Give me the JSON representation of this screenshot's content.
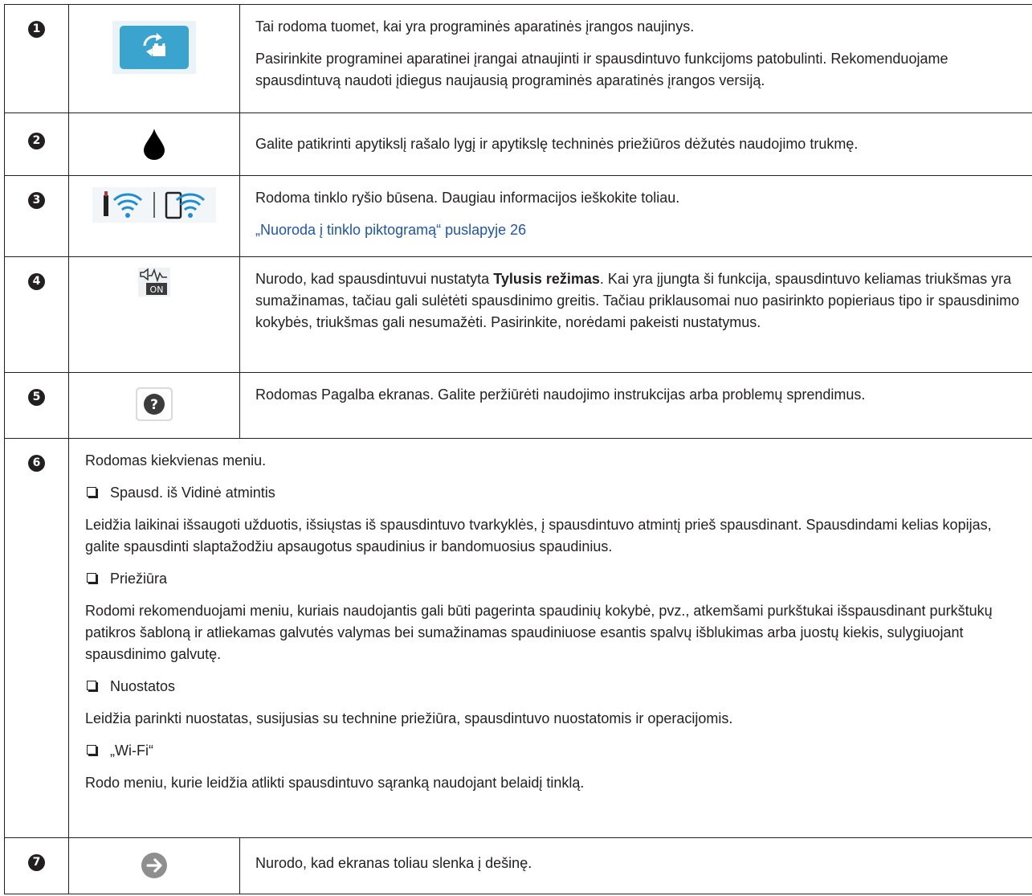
{
  "rows": [
    {
      "number": "1",
      "icon": "firmware-update-icon",
      "paragraphs": [
        "Tai rodoma tuomet, kai yra programinės aparatinės įrangos naujinys.",
        "Pasirinkite programinei aparatinei įrangai atnaujinti ir spausdintuvo funkcijoms patobulinti. Rekomenduojame spausdintuvą naudoti įdiegus naujausią programinės aparatinės įrangos versiją."
      ]
    },
    {
      "number": "2",
      "icon": "ink-drop-icon",
      "paragraphs": [
        "Galite patikrinti apytikslį rašalo lygį ir apytikslę techninės priežiūros dėžutės naudojimo trukmę."
      ]
    },
    {
      "number": "3",
      "icon": "network-status-icon",
      "paragraphs": [
        "Rodoma tinklo ryšio būsena. Daugiau informacijos ieškokite toliau."
      ],
      "link": "„Nuoroda į tinklo piktogramą“ puslapyje 26"
    },
    {
      "number": "4",
      "icon": "quiet-mode-on-icon",
      "icon_text": "ON",
      "text_before": "Nurodo, kad spausdintuvui nustatyta ",
      "text_bold": "Tylusis režimas",
      "text_after": ". Kai yra įjungta ši funkcija, spausdintuvo keliamas triukšmas yra sumažinamas, tačiau gali sulėtėti spausdinimo greitis. Tačiau priklausomai nuo pasirinkto popieriaus tipo ir spausdinimo kokybės, triukšmas gali nesumažėti. Pasirinkite, norėdami pakeisti nustatymus."
    },
    {
      "number": "5",
      "icon": "help-icon",
      "icon_text": "?",
      "paragraphs": [
        "Rodomas Pagalba ekranas. Galite peržiūrėti naudojimo instrukcijas arba problemų sprendimus."
      ]
    },
    {
      "number": "6",
      "intro": "Rodomas kiekvienas meniu.",
      "items": [
        {
          "title": "Spausd. iš Vidinė atmintis",
          "text": "Leidžia laikinai išsaugoti užduotis, išsiųstas iš spausdintuvo tvarkyklės, į spausdintuvo atmintį prieš spausdinant. Spausdindami kelias kopijas, galite spausdinti slaptažodžiu apsaugotus spaudinius ir bandomuosius spaudinius."
        },
        {
          "title": "Priežiūra",
          "text": "Rodomi rekomenduojami meniu, kuriais naudojantis gali būti pagerinta spaudinių kokybė, pvz., atkemšami purkštukai išspausdinant purkštukų patikros šabloną ir atliekamas galvutės valymas bei sumažinamas spaudiniuose esantis spalvų išblukimas arba juostų kiekis, sulygiuojant spausdinimo galvutę."
        },
        {
          "title": "Nuostatos",
          "text": "Leidžia parinkti nuostatas, susijusias su technine priežiūra, spausdintuvo nuostatomis ir operacijomis."
        },
        {
          "title": "„Wi-Fi“",
          "text": "Rodo meniu, kurie leidžia atlikti spausdintuvo sąranką naudojant belaidį tinklą."
        }
      ]
    },
    {
      "number": "7",
      "icon": "arrow-right-icon",
      "paragraphs": [
        "Nurodo, kad ekranas toliau slenka į dešinę."
      ]
    }
  ],
  "colors": {
    "text": "#231f20",
    "link": "#1f55ad",
    "firmware_icon_bg": "#3aa4cf",
    "help_icon_fill": "#3c3c3c",
    "arrow_icon_fill": "#8e8e8e"
  }
}
